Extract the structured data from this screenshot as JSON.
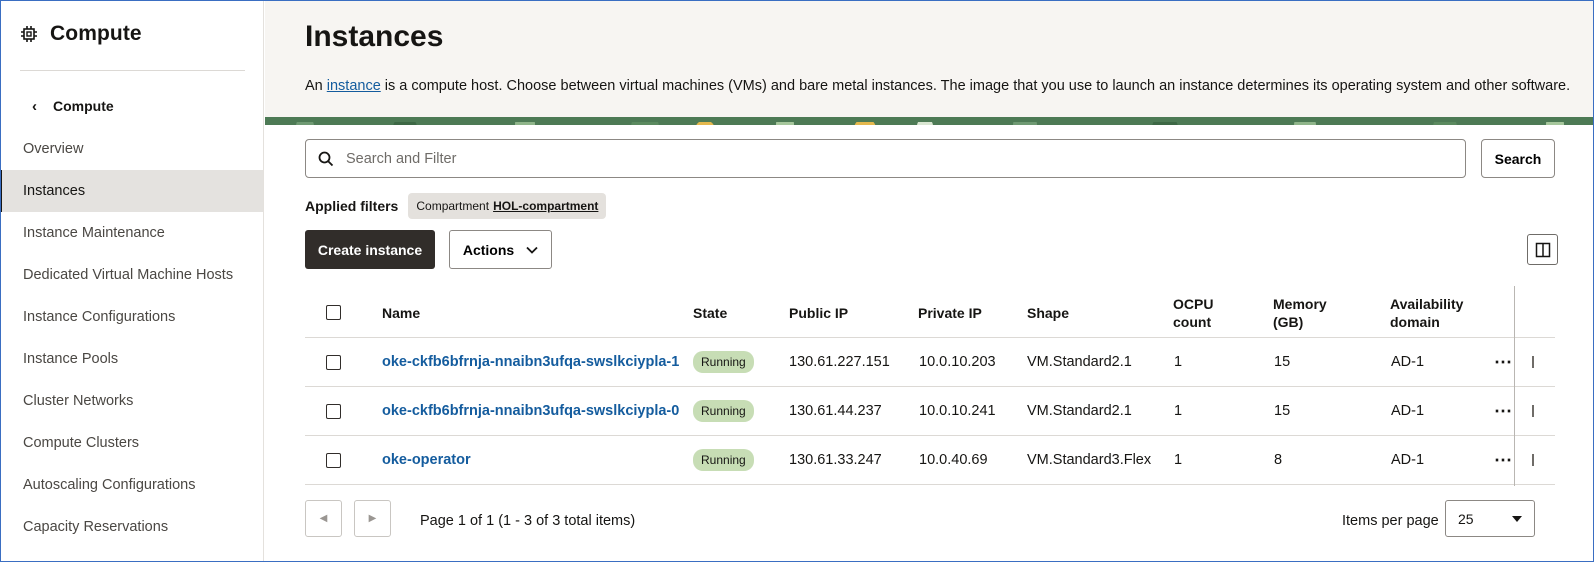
{
  "sidebar": {
    "title": "Compute",
    "back_label": "Compute",
    "items": [
      {
        "label": "Overview",
        "active": false
      },
      {
        "label": "Instances",
        "active": true
      },
      {
        "label": "Instance Maintenance",
        "active": false
      },
      {
        "label": "Dedicated Virtual Machine Hosts",
        "active": false
      },
      {
        "label": "Instance Configurations",
        "active": false
      },
      {
        "label": "Instance Pools",
        "active": false
      },
      {
        "label": "Cluster Networks",
        "active": false
      },
      {
        "label": "Compute Clusters",
        "active": false
      },
      {
        "label": "Autoscaling Configurations",
        "active": false
      },
      {
        "label": "Capacity Reservations",
        "active": false
      }
    ]
  },
  "header": {
    "title": "Instances",
    "desc_prefix": "An ",
    "desc_link": "instance",
    "desc_suffix": " is a compute host. Choose between virtual machines (VMs) and bare metal instances. The image that you use to launch an instance determines its operating system and other software."
  },
  "search": {
    "placeholder": "Search and Filter",
    "value": "",
    "button_label": "Search"
  },
  "filters": {
    "label": "Applied filters",
    "chip_key": "Compartment",
    "chip_value": "HOL-compartment"
  },
  "toolbar": {
    "create_label": "Create instance",
    "actions_label": "Actions"
  },
  "table": {
    "headers": {
      "name": "Name",
      "state": "State",
      "public_ip": "Public IP",
      "private_ip": "Private IP",
      "shape": "Shape",
      "ocpu": "OCPU count",
      "memory": "Memory (GB)",
      "ad": "Availability domain"
    },
    "rows": [
      {
        "name": "oke-ckfb6bfrnja-nnaibn3ufqa-swslkciypla-1",
        "state": "Running",
        "public_ip": "130.61.227.151",
        "private_ip": "10.0.10.203",
        "shape": "VM.Standard2.1",
        "ocpu": "1",
        "memory": "15",
        "ad": "AD-1"
      },
      {
        "name": "oke-ckfb6bfrnja-nnaibn3ufqa-swslkciypla-0",
        "state": "Running",
        "public_ip": "130.61.44.237",
        "private_ip": "10.0.10.241",
        "shape": "VM.Standard2.1",
        "ocpu": "1",
        "memory": "15",
        "ad": "AD-1"
      },
      {
        "name": "oke-operator",
        "state": "Running",
        "public_ip": "130.61.33.247",
        "private_ip": "10.0.40.69",
        "shape": "VM.Standard3.Flex",
        "ocpu": "1",
        "memory": "8",
        "ad": "AD-1"
      }
    ],
    "row_menu_label": "⋯"
  },
  "pagination": {
    "info": "Page 1 of 1 (1 - 3 of 3 total items)",
    "items_per_page_label": "Items per page",
    "items_per_page_value": "25"
  },
  "colors": {
    "accent_link": "#145c9e",
    "primary_button": "#312d2a",
    "running_badge": "#c7ddb5",
    "active_nav": "#e4e2df"
  }
}
